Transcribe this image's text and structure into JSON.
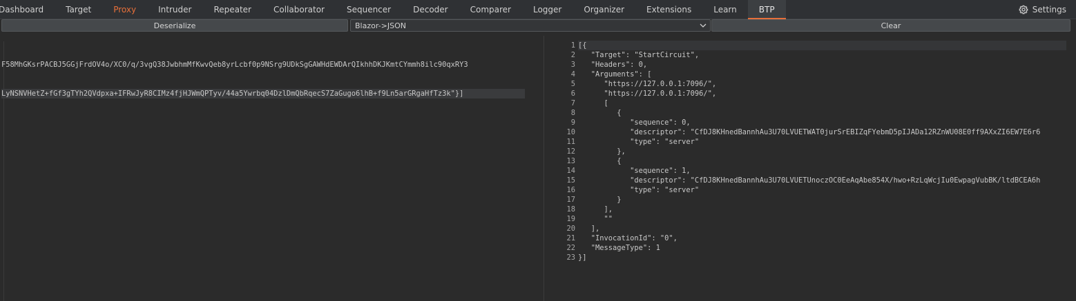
{
  "tabs": [
    {
      "label": "Dashboard"
    },
    {
      "label": "Target"
    },
    {
      "label": "Proxy"
    },
    {
      "label": "Intruder"
    },
    {
      "label": "Repeater"
    },
    {
      "label": "Collaborator"
    },
    {
      "label": "Sequencer"
    },
    {
      "label": "Decoder"
    },
    {
      "label": "Comparer"
    },
    {
      "label": "Logger"
    },
    {
      "label": "Organizer"
    },
    {
      "label": "Extensions"
    },
    {
      "label": "Learn"
    },
    {
      "label": "BTP"
    }
  ],
  "settings_label": "Settings",
  "controls": {
    "deserialize_label": "Deserialize",
    "mode_selected": "Blazor->JSON",
    "clear_label": "Clear"
  },
  "input_lines": [
    "F58MhGKsrPACBJ5GGjFrdOV4o/XC0/q/3vgQ38JwbhmMfKwvQeb8yrLcbf0p9NSrg9UDkSgGAWHdEWDArQIkhhDKJKmtCYmmh8ilc90qxRY3",
    "LyNSNVHetZ+fGf3gTYh2QVdpxa+IFRwJyR8CIMz4fjHJWmQPTyv/44a5Ywrbq04DzlDmQbRqecS7ZaGugo6lhB+f9Ln5arGRgaHfTz3k\"}]"
  ],
  "output_lines": [
    {
      "n": "1",
      "text": "[{"
    },
    {
      "n": "2",
      "text": "   \"Target\": \"StartCircuit\","
    },
    {
      "n": "3",
      "text": "   \"Headers\": 0,"
    },
    {
      "n": "4",
      "text": "   \"Arguments\": ["
    },
    {
      "n": "5",
      "text": "      \"https://127.0.0.1:7096/\","
    },
    {
      "n": "6",
      "text": "      \"https://127.0.0.1:7096/\","
    },
    {
      "n": "7",
      "text": "      ["
    },
    {
      "n": "8",
      "text": "         {"
    },
    {
      "n": "9",
      "text": "            \"sequence\": 0,"
    },
    {
      "n": "10",
      "text": "            \"descriptor\": \"CfDJ8KHnedBannhAu3U70LVUETWAT0jurSrEBIZqFYebmD5pIJADa12RZnWU08E0ff9AXxZI6EW7E6r6"
    },
    {
      "n": "11",
      "text": "            \"type\": \"server\""
    },
    {
      "n": "12",
      "text": "         },"
    },
    {
      "n": "13",
      "text": "         {"
    },
    {
      "n": "14",
      "text": "            \"sequence\": 1,"
    },
    {
      "n": "15",
      "text": "            \"descriptor\": \"CfDJ8KHnedBannhAu3U70LVUETUnoczOC0EeAqAbe854X/hwo+RzLqWcjIu0EwpagVubBK/ltdBCEA6h"
    },
    {
      "n": "16",
      "text": "            \"type\": \"server\""
    },
    {
      "n": "17",
      "text": "         }"
    },
    {
      "n": "18",
      "text": "      ],"
    },
    {
      "n": "19",
      "text": "      \"\""
    },
    {
      "n": "20",
      "text": "   ],"
    },
    {
      "n": "21",
      "text": "   \"InvocationId\": \"0\","
    },
    {
      "n": "22",
      "text": "   \"MessageType\": 1"
    },
    {
      "n": "23",
      "text": "}]"
    }
  ],
  "colors": {
    "accent": "#e8703a",
    "background": "#2b2b2b",
    "tabbar": "#2f3134",
    "button": "#45484b"
  }
}
